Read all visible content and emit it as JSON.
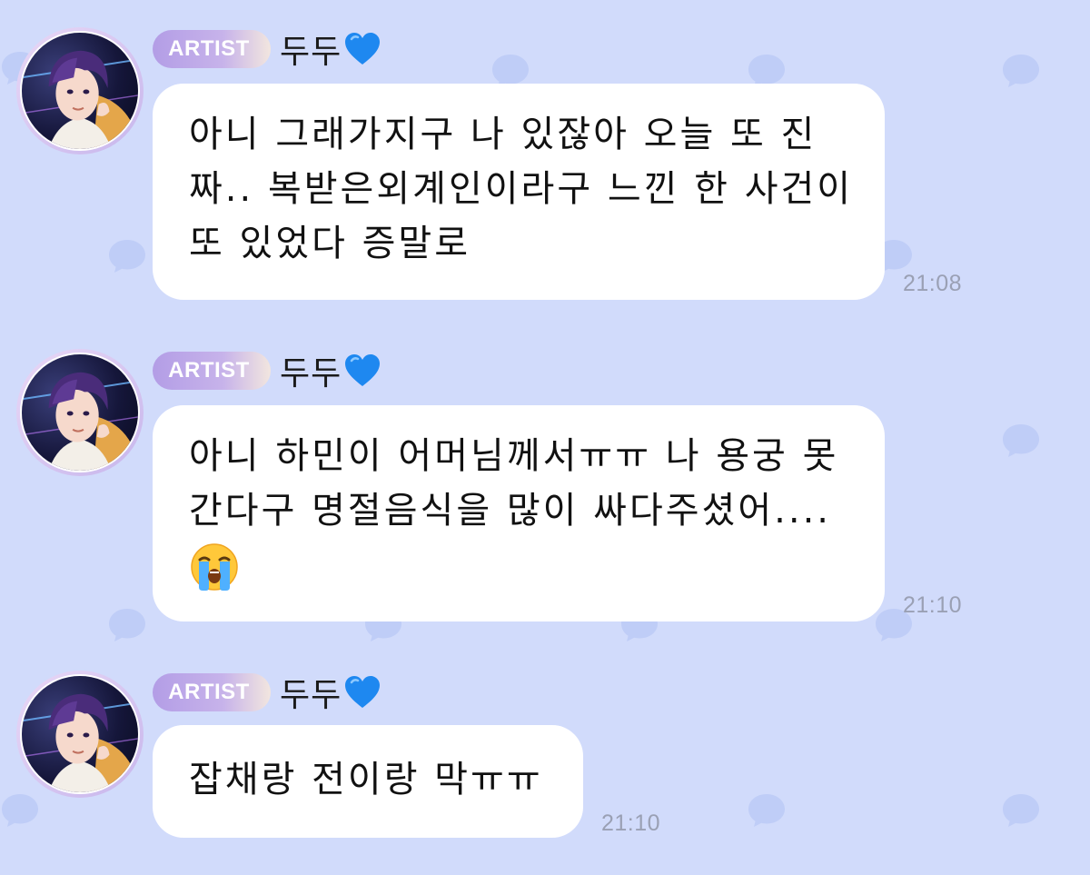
{
  "theme": {
    "background": "#d1dbfb",
    "bubble_color": "#ffffff",
    "badge_color": "#b39de6",
    "timestamp_color": "#9aa0b4",
    "heart_color": "#1e88f0"
  },
  "messages": [
    {
      "badge": "ARTIST",
      "sender": "두두",
      "sender_icon": "blue-heart-icon",
      "lines": [
        "아니 그래가지구 나 있잖아 오늘 또 진",
        "짜.. 복받은외계인이라구 느낀 한 사건이",
        "또 있었다 증말로"
      ],
      "time": "21:08"
    },
    {
      "badge": "ARTIST",
      "sender": "두두",
      "sender_icon": "blue-heart-icon",
      "lines": [
        "아니 하민이 어머님께서ㅠㅠ 나 용궁 못",
        "간다구 명절음식을 많이 싸다주셨어...."
      ],
      "emoji": "loudly-crying-face-icon",
      "time": "21:10"
    },
    {
      "badge": "ARTIST",
      "sender": "두두",
      "sender_icon": "blue-heart-icon",
      "lines": [
        "잡채랑 전이랑 막ㅠㅠ"
      ],
      "time": "21:10"
    }
  ]
}
